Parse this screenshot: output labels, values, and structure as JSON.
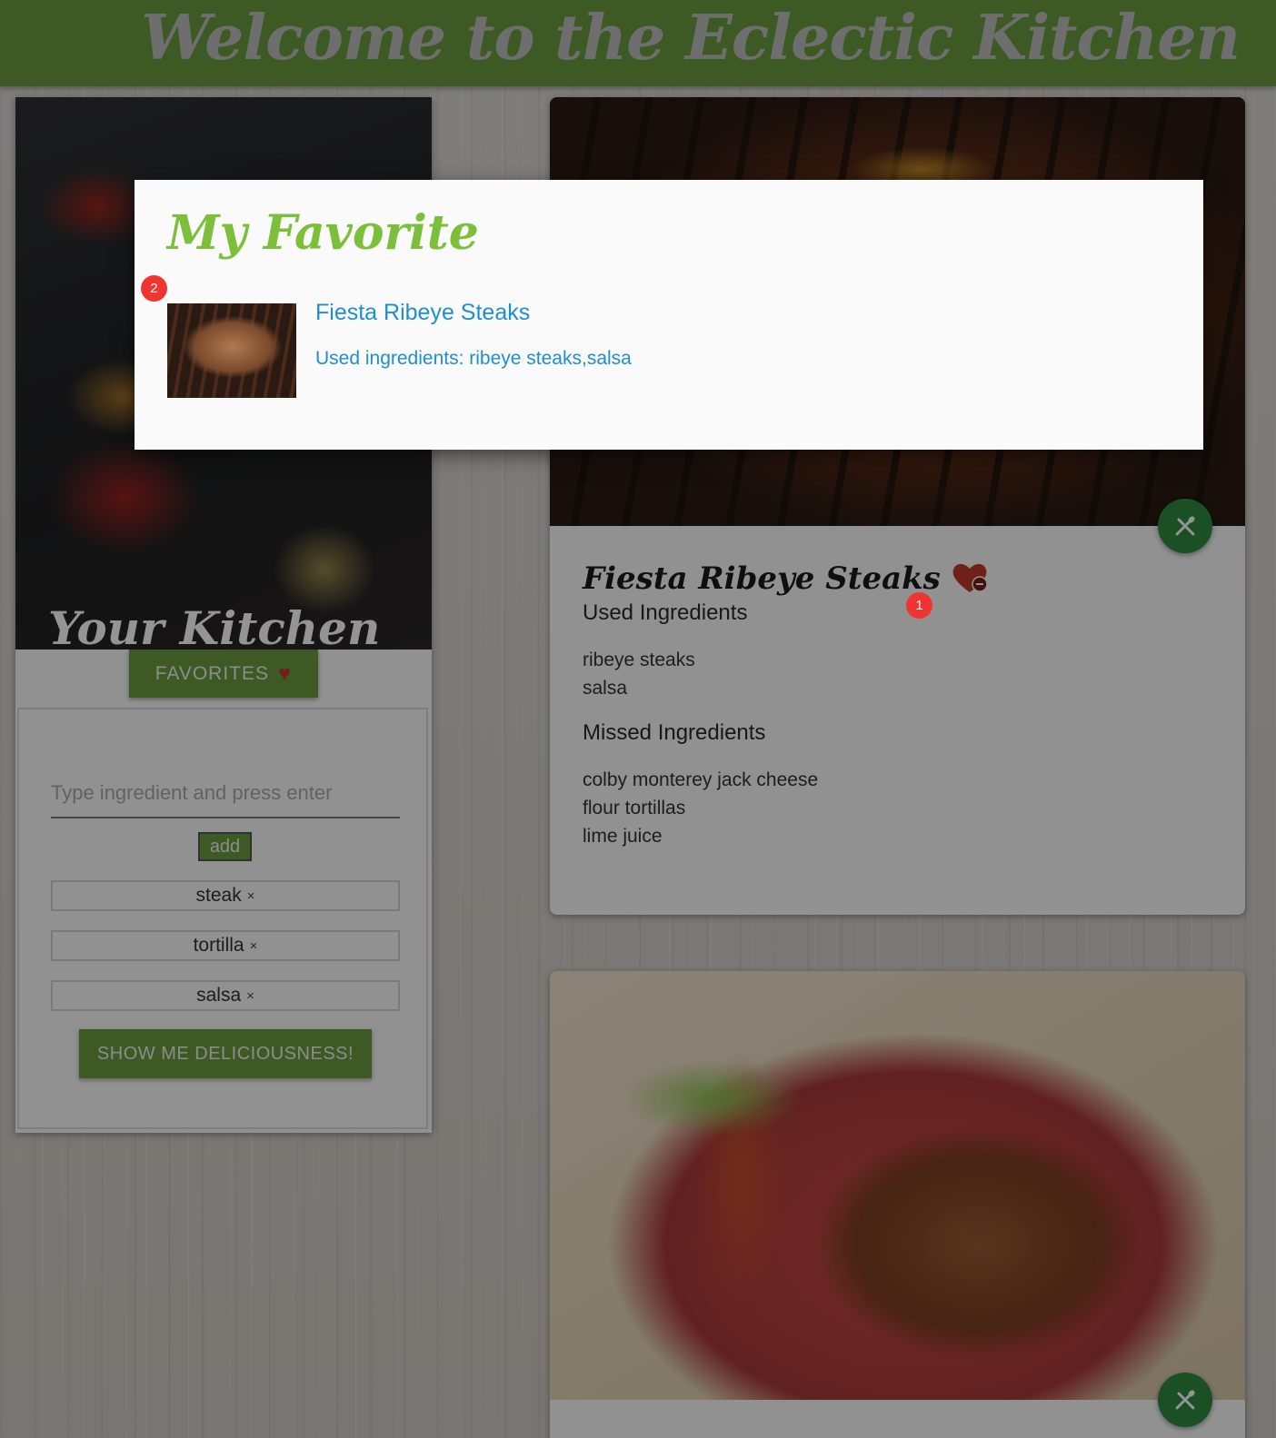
{
  "header": {
    "title": "Welcome to the Eclectic Kitchen"
  },
  "sidebar": {
    "image_title": "Your Kitchen",
    "favorites_label": "FAVORITES",
    "input": {
      "placeholder": "Type ingredient and press enter",
      "value": ""
    },
    "add_label": "add",
    "chips": [
      {
        "label": "steak",
        "remove": "×"
      },
      {
        "label": "tortilla",
        "remove": "×"
      },
      {
        "label": "salsa",
        "remove": "×"
      }
    ],
    "submit_label": "SHOW ME DELICIOUSNESS!"
  },
  "recipe": {
    "title": "Fiesta Ribeye Steaks",
    "used_heading": "Used Ingredients",
    "used": [
      "ribeye steaks",
      "salsa"
    ],
    "missed_heading": "Missed Ingredients",
    "missed": [
      "colby monterey jack cheese",
      "flour tortillas",
      "lime juice"
    ]
  },
  "modal": {
    "title": "My Favorite",
    "item": {
      "name": "Fiesta Ribeye Steaks",
      "used_text": "Used ingredients: ribeye steaks,salsa"
    }
  },
  "badges": [
    "1",
    "2"
  ],
  "colors": {
    "header_green": "#6a9c3e",
    "fab_green": "#2e8b3e",
    "link_blue": "#1e8fce",
    "modal_title_green": "#7cbf3a",
    "heart_red": "#c0392b",
    "badge_red": "#f0342f"
  },
  "icons": {
    "favorites": "heart-icon",
    "fab": "fork-spoon-icon",
    "favorite_toggle": "heart-minus-icon"
  }
}
